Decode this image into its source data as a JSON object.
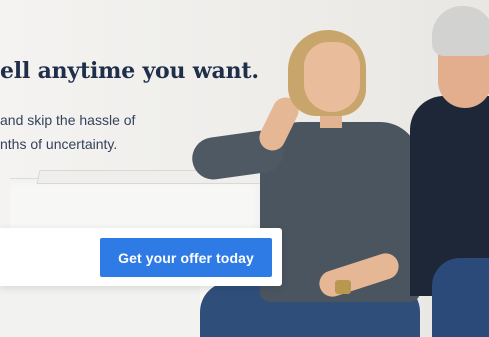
{
  "hero": {
    "headline": "ell anytime you want.",
    "subtext_lines": [
      "and skip the hassle of",
      "nths of uncertainty."
    ]
  },
  "offer": {
    "cta_label": "Get your offer today"
  },
  "colors": {
    "cta_background": "#2f7be6",
    "headline": "#1f2f4a",
    "subtext": "#34435a"
  }
}
